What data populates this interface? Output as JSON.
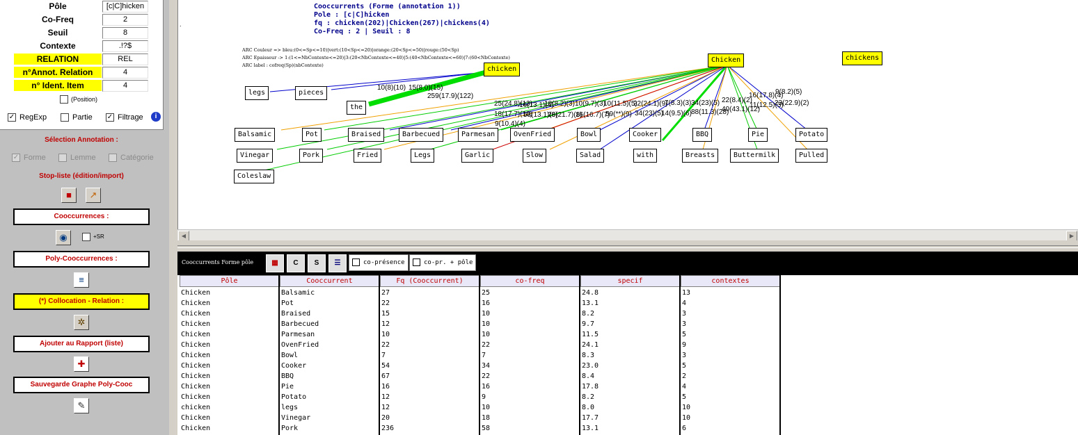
{
  "params": {
    "pole": {
      "label": "Pôle",
      "value": "[c|C]hicken"
    },
    "cofreq": {
      "label": "Co-Freq",
      "value": "2"
    },
    "seuil": {
      "label": "Seuil",
      "value": "8"
    },
    "contexte": {
      "label": "Contexte",
      "value": ".!?$"
    },
    "relation": {
      "label": "RELATION",
      "value": "REL"
    },
    "annot_relation": {
      "label": "n°Annot. Relation",
      "value": "4"
    },
    "ident_item": {
      "label": "n° Ident. Item",
      "value": "4"
    },
    "position_label": "(Position)",
    "regexp_label": "RegExp",
    "partie_label": "Partie",
    "filtrage_label": "Filtrage"
  },
  "selection": {
    "title": "Sélection Annotation :",
    "forme": "Forme",
    "lemme": "Lemme",
    "categorie": "Catégorie"
  },
  "stoplist_title": "Stop-liste (édition/import)",
  "buttons": {
    "cooccurrences": "Cooccurrences :",
    "sr_label": "+SR",
    "poly": "Poly-Cooccurrences :",
    "collocation": "(*) Collocation - Relation :",
    "ajouter": "Ajouter au Rapport (liste)",
    "sauvegarde": "Sauvegarde Graphe Poly-Cooc"
  },
  "graph": {
    "header": [
      "Cooccurrents (Forme (annotation 1))",
      "Pole : [c|C]hicken",
      "fq : chicken(202)|Chicken(267)|chickens(4)",
      "Co-Freq : 2 | Seuil : 8"
    ],
    "legend": [
      "ARC Couleur => bleu:(0<=Sp<=10)|vert:(10<Sp<=20)|orange:(20<Sp<=50)|rouge:(50<Sp)",
      "ARC Epaisseur -> 1:(1<=NbContexte<=20)|3:(20<NbContexte<=40)|5:(40<NbContexte<=60)|7:(60<NbContexte)",
      "ARC label : cofreq(Sp)(nbContexte)"
    ],
    "nodes": {
      "Chicken": "Chicken",
      "chicken": "chicken",
      "chickens": "chickens",
      "legs": "legs",
      "pieces": "pieces",
      "the": "the",
      "Balsamic": "Balsamic",
      "Pot": "Pot",
      "Braised": "Braised",
      "Barbecued": "Barbecued",
      "Parmesan": "Parmesan",
      "OvenFried": "OvenFried",
      "Bowl": "Bowl",
      "Cooker": "Cooker",
      "BBQ": "BBQ",
      "Pie": "Pie",
      "Potato": "Potato",
      "Vinegar": "Vinegar",
      "Pork": "Pork",
      "Fried": "Fried",
      "Legs": "Legs",
      "Garlic": "Garlic",
      "Slow": "Slow",
      "Salad": "Salad",
      "with": "with",
      "Breasts": "Breasts",
      "Buttermilk": "Buttermilk",
      "Pulled": "Pulled",
      "Coleslaw": "Coleslaw"
    },
    "edge_labels": [
      "10(8)(10)",
      "15(8.0)(15)",
      "259(17.9)(122)",
      "25(24.8)(13)",
      "16(13.1)(4)",
      "10(8.2)(3)",
      "10(9.7)(3)",
      "10(11.5)(5)",
      "22(24.1)(9)",
      "7(8.3)(3)",
      "34(23)(5)",
      "22(8.4)(2)",
      "16(17.8)(4)",
      "9(8.2)(5)",
      "18(17.7)(10)",
      "58(13.1)(6)",
      "28(21.7)(8)",
      "16(16.7)(7)",
      "59(**)(9)",
      "34(23)(5)",
      "14(9.5)(6)",
      "88(11.3)(28)",
      "40(43.1)(12)",
      "11(12.5)(3)",
      "23(22.9)(2)",
      "9(10.4)(4)"
    ]
  },
  "table": {
    "toolbar_label": "Cooccurrents Forme pôle",
    "copresence": "co-présence",
    "copr_pole": "co-pr. + pôle",
    "headers": [
      "Pôle",
      "Cooccurrent",
      "Fq (Cooccurrent)",
      "co-freq",
      "specif",
      "contextes"
    ],
    "rows": [
      [
        "Chicken",
        "Balsamic",
        "27",
        "25",
        "24.8",
        "13"
      ],
      [
        "Chicken",
        "Pot",
        "22",
        "16",
        "13.1",
        "4"
      ],
      [
        "Chicken",
        "Braised",
        "15",
        "10",
        "8.2",
        "3"
      ],
      [
        "Chicken",
        "Barbecued",
        "12",
        "10",
        "9.7",
        "3"
      ],
      [
        "Chicken",
        "Parmesan",
        "10",
        "10",
        "11.5",
        "5"
      ],
      [
        "Chicken",
        "OvenFried",
        "22",
        "22",
        "24.1",
        "9"
      ],
      [
        "Chicken",
        "Bowl",
        "7",
        "7",
        "8.3",
        "3"
      ],
      [
        "Chicken",
        "Cooker",
        "54",
        "34",
        "23.0",
        "5"
      ],
      [
        "Chicken",
        "BBQ",
        "67",
        "22",
        "8.4",
        "2"
      ],
      [
        "Chicken",
        "Pie",
        "16",
        "16",
        "17.8",
        "4"
      ],
      [
        "Chicken",
        "Potato",
        "12",
        "9",
        "8.2",
        "5"
      ],
      [
        "chicken",
        "legs",
        "12",
        "10",
        "8.0",
        "10"
      ],
      [
        "Chicken",
        "Vinegar",
        "20",
        "18",
        "17.7",
        "10"
      ],
      [
        "Chicken",
        "Pork",
        "236",
        "58",
        "13.1",
        "6"
      ]
    ]
  },
  "colors": {
    "accent_red": "#c00000",
    "highlight": "#ffff00",
    "blue": "#0000cc",
    "green": "#00cc00",
    "orange": "#f0a000",
    "red": "#cc0000"
  }
}
